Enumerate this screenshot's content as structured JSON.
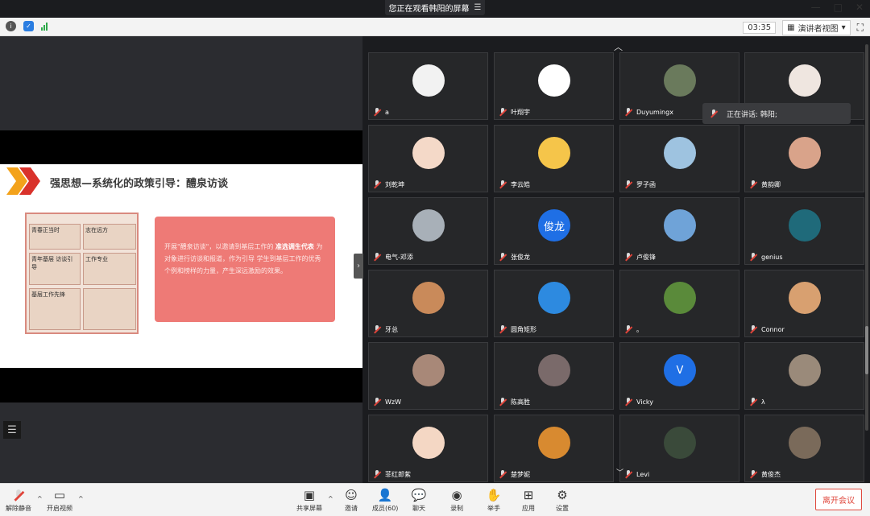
{
  "top_banner": {
    "text": "您正在观看韩阳的屏幕",
    "menu_icon": "hamburger-icon"
  },
  "window_controls": [
    "—",
    "□",
    "✕"
  ],
  "toolbar": {
    "timer": "03:35",
    "view_label": "演讲者视图",
    "view_caret": "▾"
  },
  "slide": {
    "title": "强思想—系统化的政策引导：醴泉访谈",
    "collage": {
      "c1": "青春正当时",
      "c2": "志在远方",
      "c3": "青年基层 访谈引导",
      "c4": "工作专业",
      "c5": "基层工作先锋"
    },
    "quote_line1": "开展\"醴泉访谈\"，以邀请到基层工作的",
    "quote_bold": "准选调生代表",
    "quote_line2": "为对象进行访谈和报道，作为引导",
    "quote_line3": "学生到基层工作的优秀个例和榜样的力量，产生深远激励的效果。"
  },
  "speaker_popup": {
    "label": "正在讲话: 韩阳;"
  },
  "participants": [
    {
      "name": "a",
      "avatar_text": "",
      "color": "#f2f2f2"
    },
    {
      "name": "叶翔宇",
      "avatar_text": "",
      "color": "#ffffff"
    },
    {
      "name": "Duyumingx",
      "avatar_text": "",
      "color": "#6a7a5c"
    },
    {
      "name": "",
      "avatar_text": "",
      "color": "#efe6e0"
    },
    {
      "name": "刘乾坤",
      "avatar_text": "",
      "color": "#f4d9c8"
    },
    {
      "name": "李云皓",
      "avatar_text": "",
      "color": "#f5c54a"
    },
    {
      "name": "罗子函",
      "avatar_text": "",
      "color": "#9ec3e0"
    },
    {
      "name": "黄韵卿",
      "avatar_text": "",
      "color": "#d9a38a"
    },
    {
      "name": "电气-邓添",
      "avatar_text": "",
      "color": "#a8b0b8"
    },
    {
      "name": "张俊龙",
      "avatar_text": "俊龙",
      "color": "#1f6fe5"
    },
    {
      "name": "卢俊锋",
      "avatar_text": "",
      "color": "#6fa3d8"
    },
    {
      "name": "genius",
      "avatar_text": "",
      "color": "#1f6a7a"
    },
    {
      "name": "牙总",
      "avatar_text": "",
      "color": "#c98a5a"
    },
    {
      "name": "圆角矩形",
      "avatar_text": "",
      "color": "#2d8ae0"
    },
    {
      "name": "。",
      "avatar_text": "",
      "color": "#5a8a3a"
    },
    {
      "name": "Connor",
      "avatar_text": "",
      "color": "#d8a070"
    },
    {
      "name": "WzW",
      "avatar_text": "",
      "color": "#a88878"
    },
    {
      "name": "陈高胜",
      "avatar_text": "",
      "color": "#7a6a6a"
    },
    {
      "name": "Vicky",
      "avatar_text": "V",
      "color": "#1f6fe5"
    },
    {
      "name": "λ",
      "avatar_text": "",
      "color": "#9a8a7a"
    },
    {
      "name": "菲红郎紫",
      "avatar_text": "",
      "color": "#f4d7c4"
    },
    {
      "name": "楚梦妮",
      "avatar_text": "",
      "color": "#d88a30"
    },
    {
      "name": "Levi",
      "avatar_text": "",
      "color": "#3a4a3a"
    },
    {
      "name": "黄俊杰",
      "avatar_text": "",
      "color": "#7a6a5a"
    }
  ],
  "bottom_bar": {
    "mute_label": "解除静音",
    "video_label": "开启视频",
    "share_label": "共享屏幕",
    "invite_label": "邀请",
    "members_label": "成员(60)",
    "chat_label": "聊天",
    "record_label": "录制",
    "raise_hand_label": "举手",
    "apps_label": "应用",
    "settings_label": "设置",
    "leave_label": "离开会议"
  },
  "colors": {
    "accent_red": "#e04a3f",
    "slide_quote_bg": "#ee7a76",
    "tile_bg": "#262729",
    "gallery_bg": "#1b1c1f"
  }
}
